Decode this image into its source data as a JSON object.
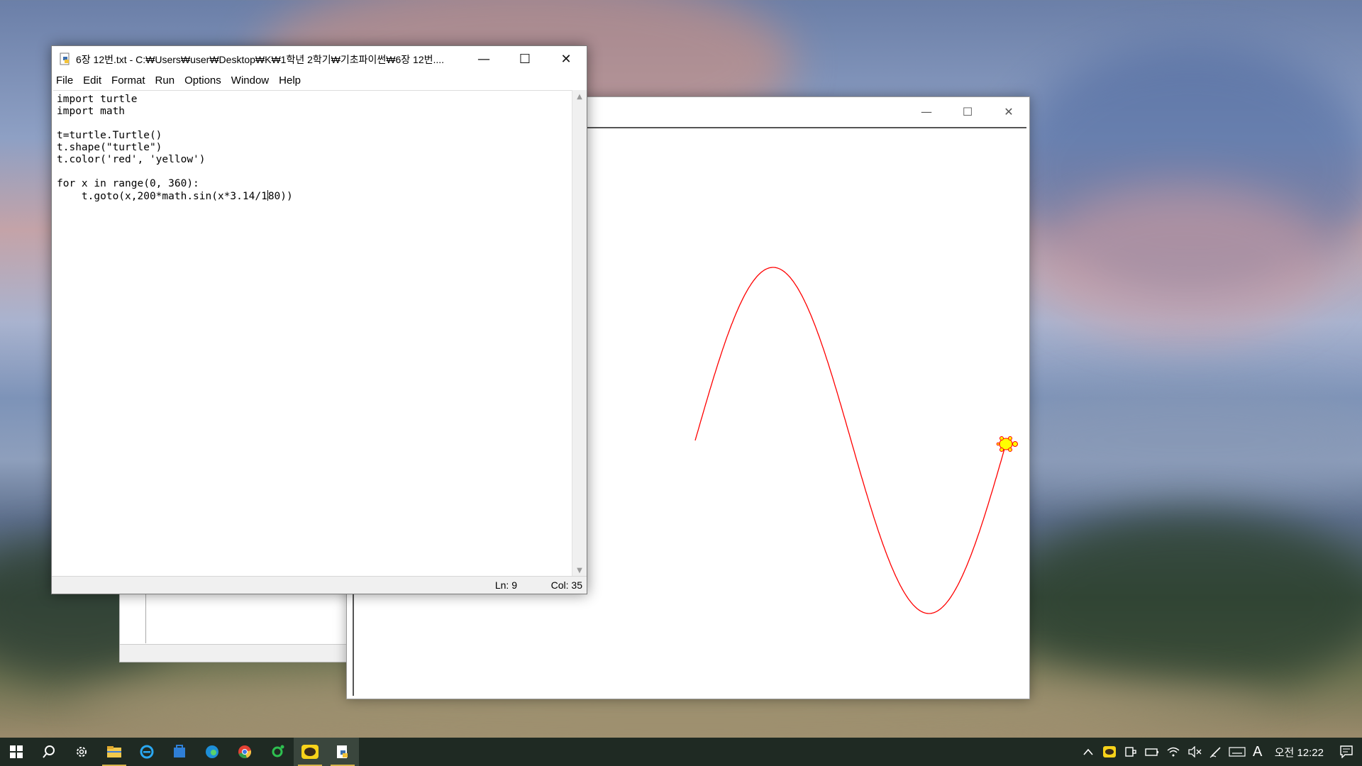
{
  "editor_window": {
    "title": "6장 12번.txt - C:₩Users₩user₩Desktop₩K₩1학년 2학기₩기초파이썬₩6장 12번....",
    "menu": [
      "File",
      "Edit",
      "Format",
      "Run",
      "Options",
      "Window",
      "Help"
    ],
    "code_lines": [
      "import turtle",
      "import math",
      "",
      "t=turtle.Turtle()",
      "t.shape(\"turtle\")",
      "t.color('red', 'yellow')",
      "",
      "for x in range(0, 360):",
      "    t.goto(x,200*math.sin(x*3.14/180))"
    ],
    "cursor": {
      "line": 9,
      "col": 35
    },
    "status": {
      "ln": "Ln: 9",
      "col": "Col: 35"
    },
    "controls": {
      "minimize": "—",
      "maximize": "☐",
      "close": "✕"
    }
  },
  "turtle_window": {
    "controls": {
      "minimize": "—",
      "maximize": "☐",
      "close": "✕"
    },
    "drawing": {
      "function": "y = 200*sin(x*3.14/180)",
      "x_range": [
        0,
        360
      ],
      "pen_color": "#ff0000",
      "turtle_fill": "#ffff00",
      "turtle_outline": "#ff0000"
    }
  },
  "taskbar": {
    "items": [
      "windows-start-icon",
      "search-icon",
      "settings-icon",
      "file-explorer-icon",
      "internet-explorer-icon",
      "store-icon",
      "edge-icon",
      "chrome-icon",
      "line-app-icon",
      "kakaotalk-icon",
      "idle-python-icon"
    ],
    "tray": {
      "ime_mode": "A",
      "clock": "오전 12:22"
    }
  }
}
